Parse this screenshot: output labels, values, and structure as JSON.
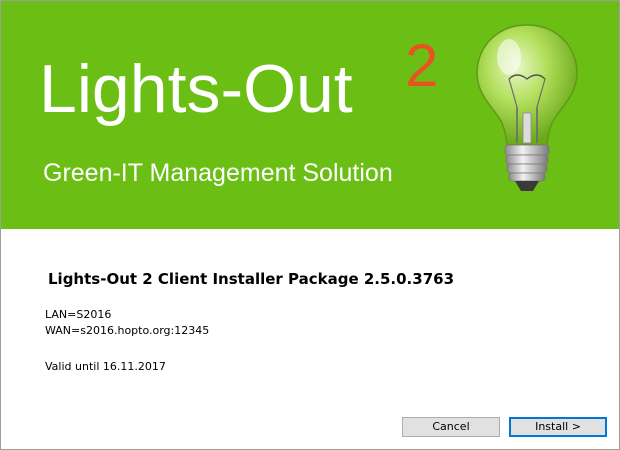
{
  "banner": {
    "title": "Lights-Out",
    "version": "2",
    "subtitle": "Green-IT Management Solution",
    "logo_icon": "light-bulb-icon",
    "background_color": "#6bbf14",
    "version_color": "#e8541f"
  },
  "content": {
    "package_title": "Lights-Out 2 Client Installer Package 2.5.0.3763",
    "lan": "LAN=S2016",
    "wan": "WAN=s2016.hopto.org:12345",
    "valid_until": "Valid until 16.11.2017"
  },
  "buttons": {
    "cancel": "Cancel",
    "install": "Install >"
  }
}
